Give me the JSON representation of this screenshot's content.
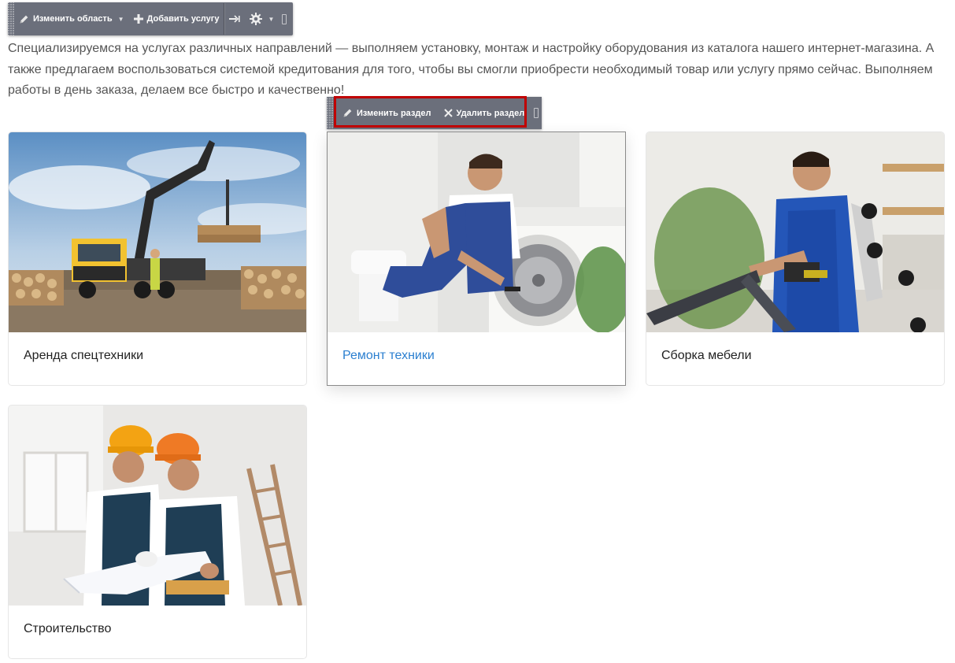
{
  "admin_toolbar": {
    "edit_area_label": "Изменить область",
    "add_service_label": "Добавить услугу",
    "icons": [
      "pencil-icon",
      "plus-icon",
      "pin-icon",
      "gear-icon"
    ]
  },
  "intro": {
    "text": "Специализируемся на услугах различных направлений — выполняем установку, монтаж и настройку оборудования из каталога нашего интернет-магазина. А также предлагаем воспользоваться системой кредитования для того, чтобы вы смогли приобрести необходимый товар или услугу прямо сейчас. Выполняем работы в день заказа, делаем все быстро и качественно!"
  },
  "section_toolbar": {
    "edit_section_label": "Изменить раздел",
    "delete_section_label": "Удалить раздел",
    "highlight_color": "#c00000"
  },
  "cards": [
    {
      "title": "Аренда спецтехники",
      "active": false
    },
    {
      "title": "Ремонт техники",
      "active": true
    },
    {
      "title": "Сборка мебели",
      "active": false
    },
    {
      "title": "Строительство",
      "active": false
    }
  ],
  "colors": {
    "toolbar_bg": "#6b6f7b",
    "link_active": "#2b7fd0",
    "text": "#555555"
  }
}
